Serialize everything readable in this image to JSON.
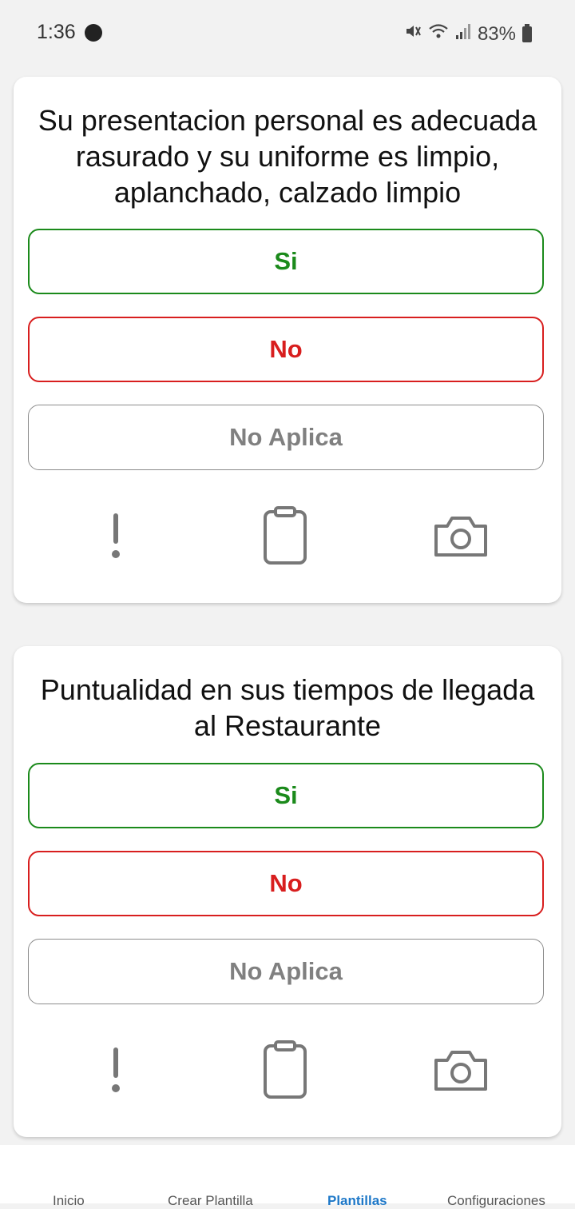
{
  "status_bar": {
    "time": "1:36",
    "battery": "83%"
  },
  "cards": [
    {
      "question": "Su presentacion personal es adecuada rasurado y su uniforme es limpio, aplanchado, calzado limpio",
      "options": {
        "yes": "Si",
        "no": "No",
        "na": "No Aplica"
      },
      "icons": [
        "exclamation-icon",
        "clipboard-icon",
        "camera-icon"
      ]
    },
    {
      "question": "Puntualidad en sus tiempos de llegada al Restaurante",
      "options": {
        "yes": "Si",
        "no": "No",
        "na": "No Aplica"
      },
      "icons": [
        "exclamation-icon",
        "clipboard-icon",
        "camera-icon"
      ]
    }
  ],
  "bottom_nav": {
    "items": [
      {
        "label": "Inicio",
        "active": false
      },
      {
        "label": "Crear Plantilla",
        "active": false
      },
      {
        "label": "Plantillas",
        "active": true
      },
      {
        "label": "Configuraciones",
        "active": false
      }
    ]
  },
  "colors": {
    "yes": "#1b8a1b",
    "no": "#d81e1e",
    "na": "#808080",
    "nav_active": "#1e78c8"
  }
}
